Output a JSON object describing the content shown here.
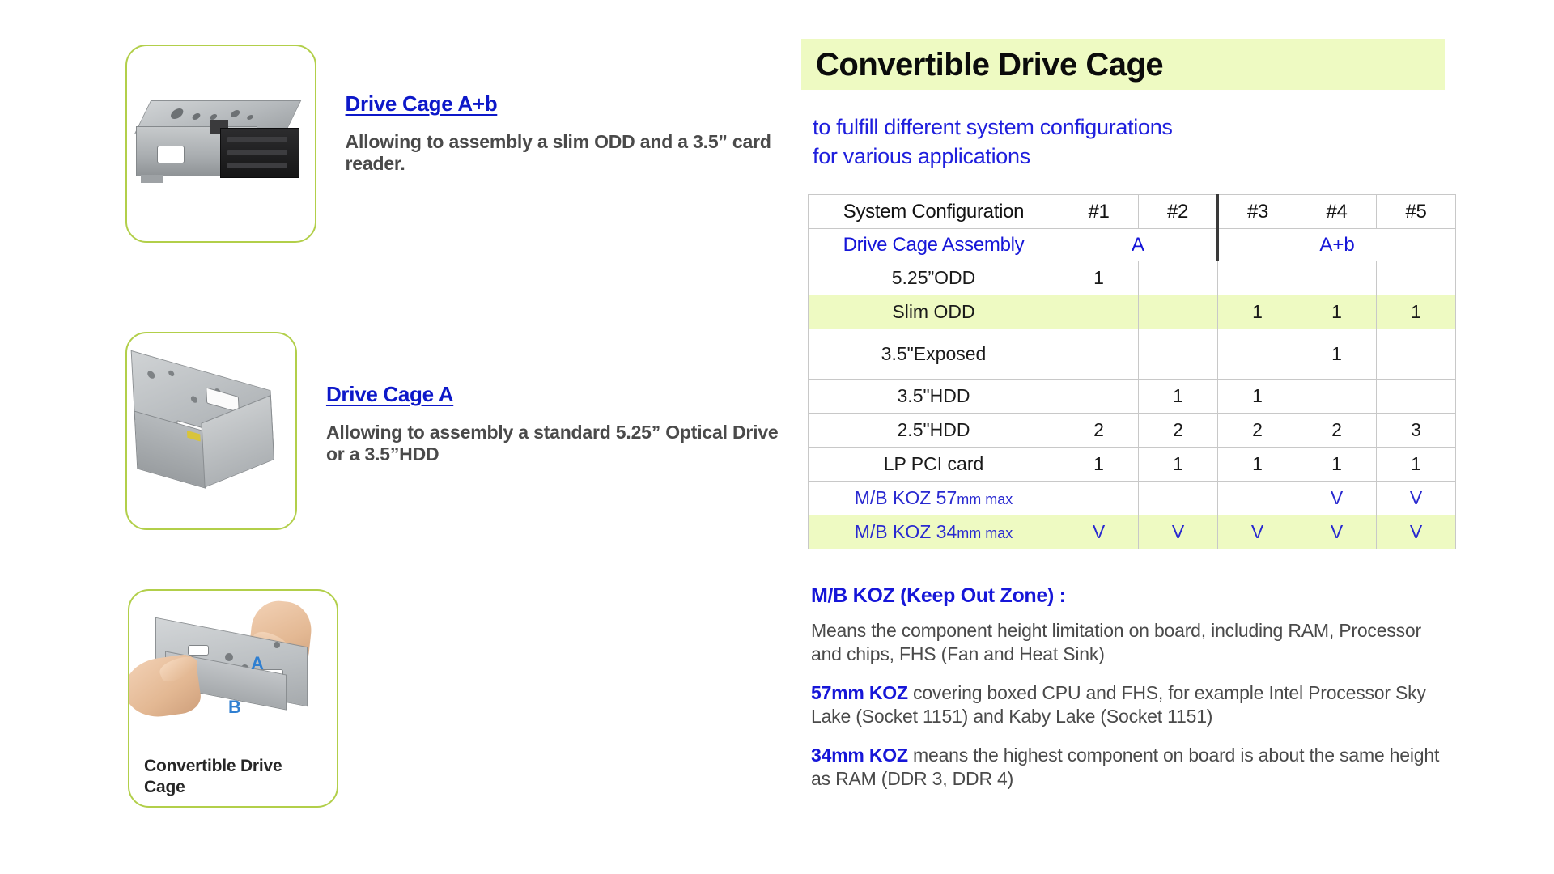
{
  "left_column": {
    "products": [
      {
        "link_label": "Drive Cage A+b",
        "description": "Allowing to assembly a slim ODD and a 3.5” card reader.",
        "image_name": "drive-cage-a-plus-b-photo"
      },
      {
        "link_label": "Drive Cage A",
        "description": "Allowing to assembly a standard 5.25” Optical Drive or a 3.5”HDD",
        "image_name": "drive-cage-a-photo"
      }
    ],
    "convertible_card": {
      "caption": "Convertible Drive Cage",
      "label_a": "A",
      "label_b": "B",
      "image_name": "convertible-drive-cage-hands-photo"
    }
  },
  "right_column": {
    "banner_title": "Convertible Drive Cage",
    "subtitle_line1": "to fulfill different system configurations",
    "subtitle_line2": "for various applications",
    "notes": {
      "heading": "M/B KOZ (Keep Out Zone) :",
      "p1": "Means the component height limitation on board, including RAM, Processor and chips, FHS (Fan and Heat Sink)",
      "p2_keyword": "57mm KOZ",
      "p2_rest": " covering boxed CPU and FHS, for example Intel Processor Sky Lake (Socket 1151) and Kaby Lake (Socket 1151)",
      "p3_keyword": "34mm KOZ",
      "p3_rest": " means the highest component on board is about the same height as RAM (DDR 3, DDR 4)"
    }
  },
  "chart_data": {
    "type": "table",
    "title": "Convertible Drive Cage — System Configuration matrix",
    "header_label": "System Configuration",
    "columns": [
      "#1",
      "#2",
      "#3",
      "#4",
      "#5"
    ],
    "assembly_row": {
      "label": "Drive Cage Assembly",
      "groups": [
        {
          "value": "A",
          "columns": [
            "#1",
            "#2"
          ]
        },
        {
          "value": "A+b",
          "columns": [
            "#3",
            "#4",
            "#5"
          ]
        }
      ]
    },
    "rows": [
      {
        "label": "5.25”ODD",
        "values": [
          "1",
          "",
          "",
          "",
          ""
        ],
        "highlight": false,
        "blue": false,
        "tall": false
      },
      {
        "label": "Slim ODD",
        "values": [
          "",
          "",
          "1",
          "1",
          "1"
        ],
        "highlight": true,
        "blue": false,
        "tall": false
      },
      {
        "label": "3.5\"Exposed",
        "values": [
          "",
          "",
          "",
          "1",
          ""
        ],
        "highlight": false,
        "blue": false,
        "tall": true
      },
      {
        "label": "3.5\"HDD",
        "values": [
          "",
          "1",
          "1",
          "",
          ""
        ],
        "highlight": false,
        "blue": false,
        "tall": false
      },
      {
        "label": "2.5\"HDD",
        "values": [
          "2",
          "2",
          "2",
          "2",
          "3"
        ],
        "highlight": false,
        "blue": false,
        "tall": false
      },
      {
        "label": "LP PCI card",
        "values": [
          "1",
          "1",
          "1",
          "1",
          "1"
        ],
        "highlight": false,
        "blue": false,
        "tall": false
      },
      {
        "label_main": "M/B KOZ 57",
        "label_small": "mm max",
        "label": "M/B KOZ 57mm max",
        "values": [
          "",
          "",
          "",
          "V",
          "V"
        ],
        "highlight": false,
        "blue": true,
        "tall": false
      },
      {
        "label_main": "M/B KOZ 34",
        "label_small": "mm max",
        "label": "M/B KOZ 34mm max",
        "values": [
          "V",
          "V",
          "V",
          "V",
          "V"
        ],
        "highlight": true,
        "blue": true,
        "tall": false
      }
    ],
    "colors": {
      "highlight_row": "#eefac2",
      "blue_text": "#2a2ad0",
      "banner_bg": "#eefac2",
      "border": "#c8c8c8",
      "group_divider": "#3a3a3a",
      "card_border": "#b2cf4a",
      "link": "#0d18c9"
    }
  }
}
